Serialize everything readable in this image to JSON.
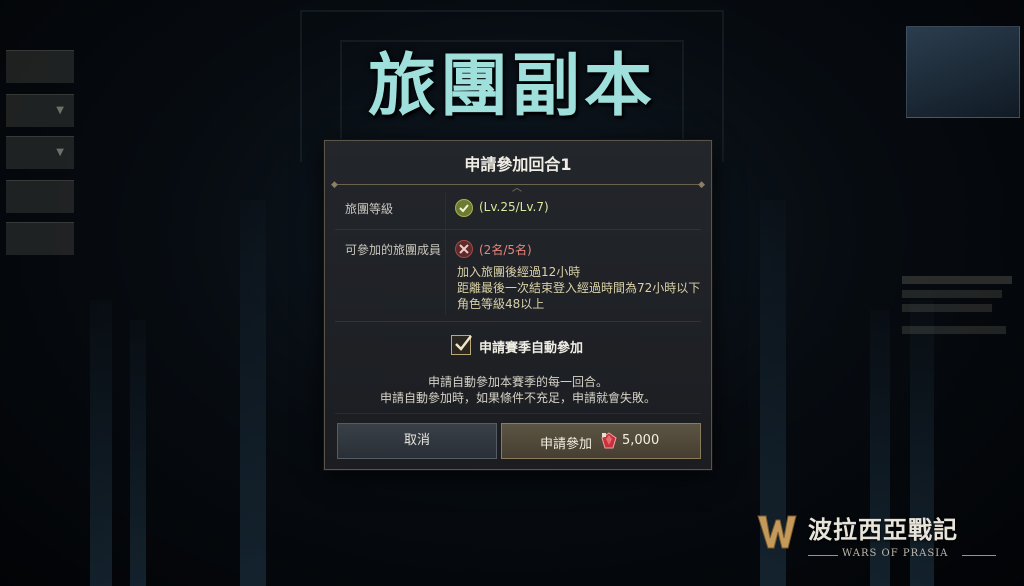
{
  "page": {
    "title": "旅團副本"
  },
  "dialog": {
    "title": "申請參加回合1",
    "rows": [
      {
        "label": "旅團等級",
        "status": "ok",
        "value": "(Lv.25/Lv.7)"
      },
      {
        "label": "可參加的旅團成員",
        "status": "fail",
        "value": "(2名/5名)"
      }
    ],
    "conditions": [
      "加入旅團後經過12小時",
      "距離最後一次結束登入經過時間為72小時以下",
      "角色等級48以上"
    ],
    "auto_join": {
      "checked": true,
      "label": "申請賽季自動參加"
    },
    "description": [
      "申請自動參加本賽季的每一回合。",
      "申請自動參加時，如果條件不充足，申請就會失敗。"
    ],
    "buttons": {
      "cancel": "取消",
      "apply": "申請參加",
      "apply_cost": "5,000",
      "apply_cost_icon": "red-gem-icon"
    }
  },
  "logo": {
    "name": "波拉西亞戰記",
    "subtitle": "WARS OF PRASIA"
  },
  "colors": {
    "title_teal": "#9fe0dc",
    "ok_green": "#d7e89a",
    "fail_red": "#e4857e",
    "condition_text": "#d9d2a8"
  }
}
